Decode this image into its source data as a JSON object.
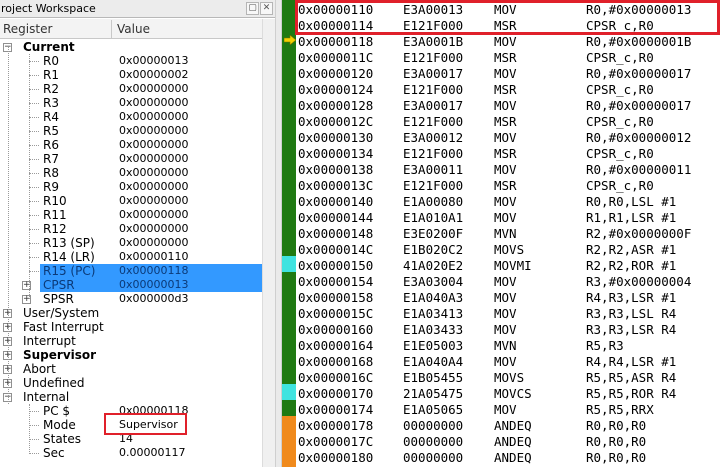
{
  "workspace": {
    "title": "roject Workspace",
    "columns": {
      "register": "Register",
      "value": "Value"
    }
  },
  "current": {
    "label": "Current",
    "registers": [
      {
        "name": "R0",
        "value": "0x00000013"
      },
      {
        "name": "R1",
        "value": "0x00000002"
      },
      {
        "name": "R2",
        "value": "0x00000000"
      },
      {
        "name": "R3",
        "value": "0x00000000"
      },
      {
        "name": "R4",
        "value": "0x00000000"
      },
      {
        "name": "R5",
        "value": "0x00000000"
      },
      {
        "name": "R6",
        "value": "0x00000000"
      },
      {
        "name": "R7",
        "value": "0x00000000"
      },
      {
        "name": "R8",
        "value": "0x00000000"
      },
      {
        "name": "R9",
        "value": "0x00000000"
      },
      {
        "name": "R10",
        "value": "0x00000000"
      },
      {
        "name": "R11",
        "value": "0x00000000"
      },
      {
        "name": "R12",
        "value": "0x00000000"
      },
      {
        "name": "R13 (SP)",
        "value": "0x00000000"
      },
      {
        "name": "R14 (LR)",
        "value": "0x00000110"
      },
      {
        "name": "R15 (PC)",
        "value": "0x00000118"
      }
    ],
    "cpsr": {
      "name": "CPSR",
      "value": "0x00000013"
    },
    "spsr": {
      "name": "SPSR",
      "value": "0x000000d3"
    }
  },
  "modes": [
    "User/System",
    "Fast Interrupt",
    "Interrupt",
    "Supervisor",
    "Abort",
    "Undefined"
  ],
  "internal": {
    "label": "Internal",
    "items": [
      {
        "name": "PC  $",
        "value": "0x00000118"
      },
      {
        "name": "Mode",
        "value": "Supervisor"
      },
      {
        "name": "States",
        "value": "14"
      },
      {
        "name": "Sec",
        "value": "0.00000117"
      }
    ]
  },
  "disassembly": [
    {
      "addr": "0x00000110",
      "op": "E3A00013",
      "mn": "MOV",
      "args": "R0,#0x00000013"
    },
    {
      "addr": "0x00000114",
      "op": "E121F000",
      "mn": "MSR",
      "args": "CPSR_c,R0"
    },
    {
      "addr": "0x00000118",
      "op": "E3A0001B",
      "mn": "MOV",
      "args": "R0,#0x0000001B"
    },
    {
      "addr": "0x0000011C",
      "op": "E121F000",
      "mn": "MSR",
      "args": "CPSR_c,R0"
    },
    {
      "addr": "0x00000120",
      "op": "E3A00017",
      "mn": "MOV",
      "args": "R0,#0x00000017"
    },
    {
      "addr": "0x00000124",
      "op": "E121F000",
      "mn": "MSR",
      "args": "CPSR_c,R0"
    },
    {
      "addr": "0x00000128",
      "op": "E3A00017",
      "mn": "MOV",
      "args": "R0,#0x00000017"
    },
    {
      "addr": "0x0000012C",
      "op": "E121F000",
      "mn": "MSR",
      "args": "CPSR_c,R0"
    },
    {
      "addr": "0x00000130",
      "op": "E3A00012",
      "mn": "MOV",
      "args": "R0,#0x00000012"
    },
    {
      "addr": "0x00000134",
      "op": "E121F000",
      "mn": "MSR",
      "args": "CPSR_c,R0"
    },
    {
      "addr": "0x00000138",
      "op": "E3A00011",
      "mn": "MOV",
      "args": "R0,#0x00000011"
    },
    {
      "addr": "0x0000013C",
      "op": "E121F000",
      "mn": "MSR",
      "args": "CPSR_c,R0"
    },
    {
      "addr": "0x00000140",
      "op": "E1A00080",
      "mn": "MOV",
      "args": "R0,R0,LSL #1"
    },
    {
      "addr": "0x00000144",
      "op": "E1A010A1",
      "mn": "MOV",
      "args": "R1,R1,LSR #1"
    },
    {
      "addr": "0x00000148",
      "op": "E3E0200F",
      "mn": "MVN",
      "args": "R2,#0x0000000F"
    },
    {
      "addr": "0x0000014C",
      "op": "E1B020C2",
      "mn": "MOVS",
      "args": "R2,R2,ASR #1"
    },
    {
      "addr": "0x00000150",
      "op": "41A020E2",
      "mn": "MOVMI",
      "args": "R2,R2,ROR #1"
    },
    {
      "addr": "0x00000154",
      "op": "E3A03004",
      "mn": "MOV",
      "args": "R3,#0x00000004"
    },
    {
      "addr": "0x00000158",
      "op": "E1A040A3",
      "mn": "MOV",
      "args": "R4,R3,LSR #1"
    },
    {
      "addr": "0x0000015C",
      "op": "E1A03413",
      "mn": "MOV",
      "args": "R3,R3,LSL R4"
    },
    {
      "addr": "0x00000160",
      "op": "E1A03433",
      "mn": "MOV",
      "args": "R3,R3,LSR R4"
    },
    {
      "addr": "0x00000164",
      "op": "E1E05003",
      "mn": "MVN",
      "args": "R5,R3"
    },
    {
      "addr": "0x00000168",
      "op": "E1A040A4",
      "mn": "MOV",
      "args": "R4,R4,LSR #1"
    },
    {
      "addr": "0x0000016C",
      "op": "E1B05455",
      "mn": "MOVS",
      "args": "R5,R5,ASR R4"
    },
    {
      "addr": "0x00000170",
      "op": "21A05475",
      "mn": "MOVCS",
      "args": "R5,R5,ROR R4"
    },
    {
      "addr": "0x00000174",
      "op": "E1A05065",
      "mn": "MOV",
      "args": "R5,R5,RRX"
    },
    {
      "addr": "0x00000178",
      "op": "00000000",
      "mn": "ANDEQ",
      "args": "R0,R0,R0"
    },
    {
      "addr": "0x0000017C",
      "op": "00000000",
      "mn": "ANDEQ",
      "args": "R0,R0,R0"
    },
    {
      "addr": "0x00000180",
      "op": "00000000",
      "mn": "ANDEQ",
      "args": "R0,R0,R0"
    }
  ],
  "colors": {
    "executed": "#1f7a12",
    "branch_marker": "#3fe3e0",
    "not_executed": "#f08a1c",
    "selection": "#3399ff",
    "highlight_box": "#e0202a"
  }
}
